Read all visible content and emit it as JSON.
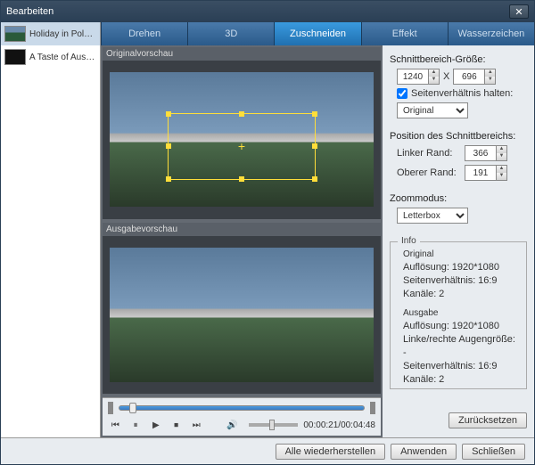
{
  "window": {
    "title": "Bearbeiten"
  },
  "sidebar": {
    "items": [
      {
        "label": "Holiday in Polan..."
      },
      {
        "label": "A Taste of Austri..."
      }
    ]
  },
  "tabs": [
    {
      "label": "Drehen"
    },
    {
      "label": "3D"
    },
    {
      "label": "Zuschneiden"
    },
    {
      "label": "Effekt"
    },
    {
      "label": "Wasserzeichen"
    }
  ],
  "preview": {
    "original_label": "Originalvorschau",
    "output_label": "Ausgabevorschau"
  },
  "playback": {
    "time": "00:00:21/00:04:48"
  },
  "crop": {
    "size_label": "Schnittbereich-Größe:",
    "width": "1240",
    "x": "X",
    "height": "696",
    "keep_ratio_label": "Seitenverhältnis halten:",
    "ratio_values": [
      "Original"
    ],
    "pos_label": "Position des Schnittbereichs:",
    "left_label": "Linker Rand:",
    "left": "366",
    "top_label": "Oberer Rand:",
    "top": "191",
    "zoom_label": "Zoommodus:",
    "zoom_values": [
      "Letterbox"
    ]
  },
  "info": {
    "box_label": "Info",
    "orig_label": "Original",
    "orig_res_label": "Auflösung:",
    "orig_res": "1920*1080",
    "orig_ratio_label": "Seitenverhältnis:",
    "orig_ratio": "16:9",
    "orig_ch_label": "Kanäle:",
    "orig_ch": "2",
    "out_label": "Ausgabe",
    "out_res_label": "Auflösung:",
    "out_res": "1920*1080",
    "out_eye_label": "Linke/rechte Augengröße:",
    "out_eye": "-",
    "out_ratio_label": "Seitenverhältnis:",
    "out_ratio": "16:9",
    "out_ch_label": "Kanäle:",
    "out_ch": "2"
  },
  "buttons": {
    "reset": "Zurücksetzen",
    "restore_all": "Alle wiederherstellen",
    "apply": "Anwenden",
    "close": "Schließen"
  }
}
